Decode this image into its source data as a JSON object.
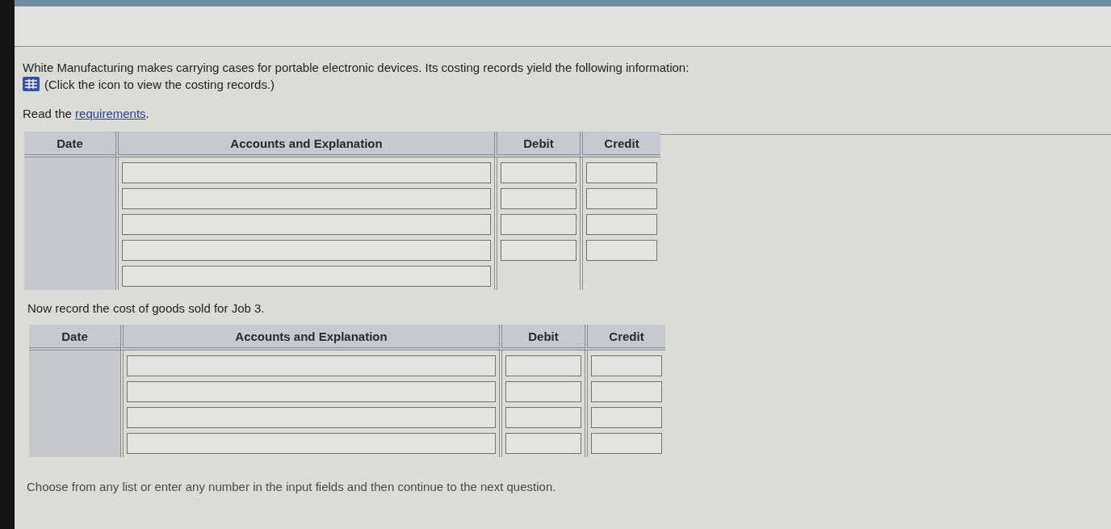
{
  "intro": {
    "text": "White Manufacturing makes carrying cases for portable electronic devices. Its costing records yield the following information:",
    "icon_hint": "(Click the icon to view the costing records.)"
  },
  "requirements": {
    "text": "Read the ",
    "link": "requirements",
    "after": "."
  },
  "journals": [
    {
      "columns": [
        "Date",
        "Accounts and Explanation",
        "Debit",
        "Credit"
      ],
      "rows": [
        {
          "kind": "amount"
        },
        {
          "kind": "amount"
        },
        {
          "kind": "amount"
        },
        {
          "kind": "amount"
        },
        {
          "kind": "explanation"
        }
      ]
    },
    {
      "prompt": "Now record the cost of goods sold for Job 3.",
      "columns": [
        "Date",
        "Accounts and Explanation",
        "Debit",
        "Credit"
      ],
      "rows": [
        {
          "kind": "amount"
        },
        {
          "kind": "amount"
        },
        {
          "kind": "amount"
        },
        {
          "kind": "amount"
        }
      ]
    }
  ],
  "footer": "Choose from any list or enter any number in the input fields and then continue to the next question."
}
